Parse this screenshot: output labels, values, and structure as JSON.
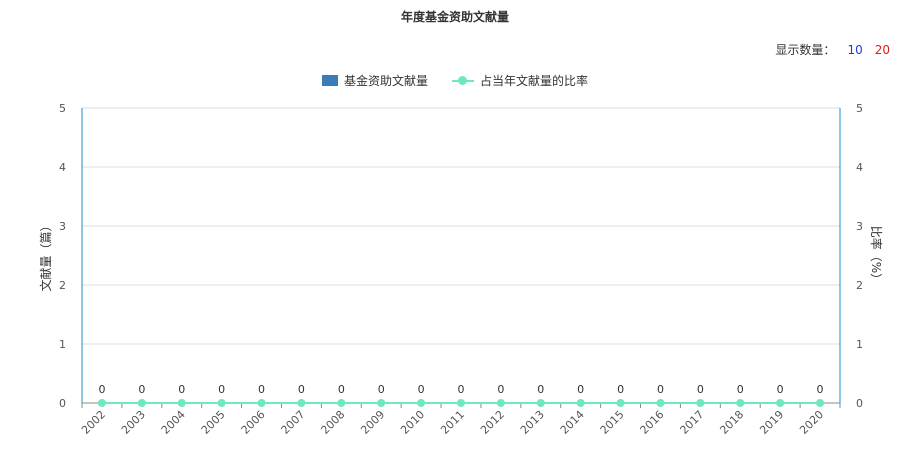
{
  "count_selector": {
    "label": "显示数量：",
    "options": [
      "10",
      "20"
    ]
  },
  "colors": {
    "bar": "#3d7ab8",
    "line": "#6ee8c0",
    "axis_left": "#1f8fc6",
    "axis_right": "#1f8fc6",
    "grid": "#dddddd"
  },
  "chart_data": {
    "type": "bar",
    "title": "年度基金资助文献量",
    "categories": [
      "2002",
      "2003",
      "2004",
      "2005",
      "2006",
      "2007",
      "2008",
      "2009",
      "2010",
      "2011",
      "2012",
      "2013",
      "2014",
      "2015",
      "2016",
      "2017",
      "2018",
      "2019",
      "2020"
    ],
    "series": [
      {
        "name": "基金资助文献量",
        "type": "bar",
        "values": [
          0,
          0,
          0,
          0,
          0,
          0,
          0,
          0,
          0,
          0,
          0,
          0,
          0,
          0,
          0,
          0,
          0,
          0,
          0
        ]
      },
      {
        "name": "占当年文献量的比率",
        "type": "line",
        "values": [
          0,
          0,
          0,
          0,
          0,
          0,
          0,
          0,
          0,
          0,
          0,
          0,
          0,
          0,
          0,
          0,
          0,
          0,
          0
        ]
      }
    ],
    "data_labels": [
      "0",
      "0",
      "0",
      "0",
      "0",
      "0",
      "0",
      "0",
      "0",
      "0",
      "0",
      "0",
      "0",
      "0",
      "0",
      "0",
      "0",
      "0",
      "0"
    ],
    "ylabel": "文献量（篇）",
    "ylabel_right": "比率（%）",
    "ylim": [
      0,
      5
    ],
    "ylim_right": [
      0,
      5
    ],
    "yticks": [
      "0",
      "1",
      "2",
      "3",
      "4",
      "5"
    ],
    "yticks_right": [
      "0",
      "1",
      "2",
      "3",
      "4",
      "5"
    ],
    "grid": true,
    "legend": "top-center"
  }
}
